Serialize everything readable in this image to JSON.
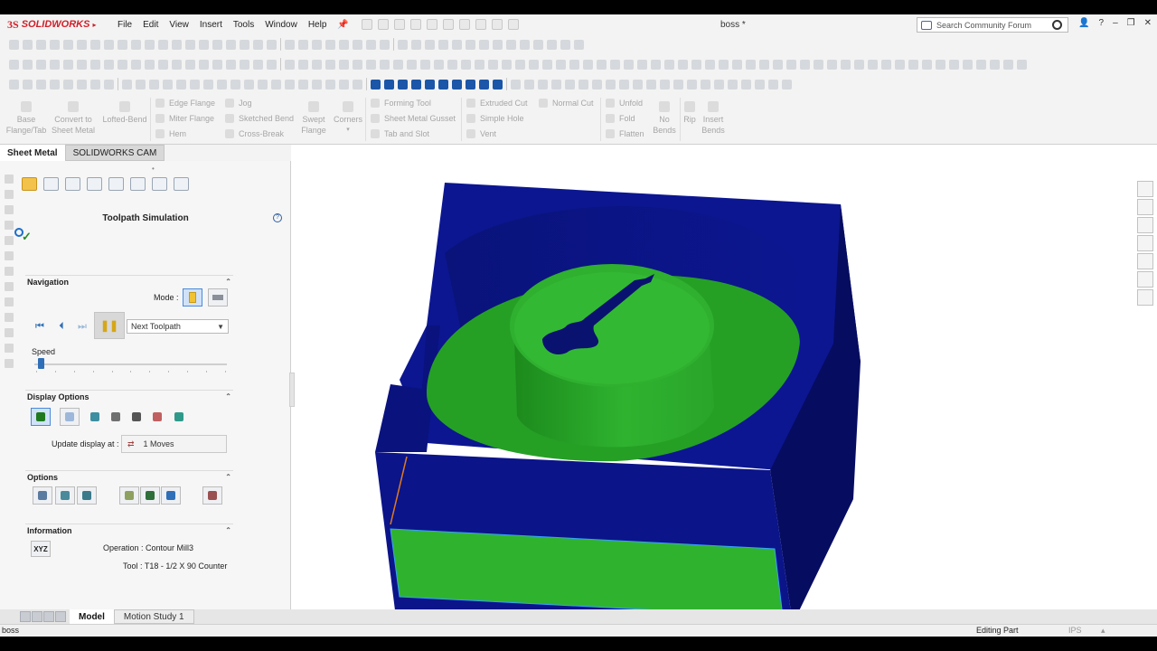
{
  "app": {
    "logo_mark": "3S",
    "logo_text": "SOLIDWORKS",
    "document_title": "boss *",
    "menu": [
      "File",
      "Edit",
      "View",
      "Insert",
      "Tools",
      "Window",
      "Help"
    ],
    "search_placeholder": "Search Community Forum",
    "window_controls": [
      "?",
      "–",
      "❐",
      "✕"
    ]
  },
  "command_manager": {
    "large": [
      {
        "label": "Base\nFlange/Tab"
      },
      {
        "label": "Convert to\nSheet Metal"
      },
      {
        "label": "Lofted-Bend"
      }
    ],
    "column1": [
      "Edge Flange",
      "Miter Flange",
      "Hem"
    ],
    "column2": [
      "Jog",
      "Sketched Bend",
      "Cross-Break"
    ],
    "swept": "Swept\nFlange",
    "corners": "Corners",
    "column3": [
      "Forming Tool",
      "Sheet Metal Gusset",
      "Tab and Slot"
    ],
    "column4": [
      "Extruded Cut",
      "Simple Hole",
      "Vent"
    ],
    "normal_cut": "Normal Cut",
    "column5": [
      "Unfold",
      "Fold",
      "Flatten"
    ],
    "no_bends": "No\nBends",
    "rip": "Rip",
    "insert_bends": "Insert\nBends"
  },
  "tabs": [
    "Sheet Metal",
    "SOLIDWORKS CAM"
  ],
  "property_manager": {
    "title": "Toolpath Simulation",
    "navigation": {
      "heading": "Navigation",
      "mode_label": "Mode :",
      "step_selected": "Next Toolpath",
      "speed_label": "Speed",
      "speed_level_percent": 2
    },
    "display_options": {
      "heading": "Display Options",
      "update_label": "Update display at :",
      "update_value": "1 Moves"
    },
    "options": {
      "heading": "Options"
    },
    "information": {
      "heading": "Information",
      "xyz_label": "XYZ",
      "operation": "Operation :  Contour Mill3",
      "tool": "Tool :  T18 - 1/2 X 90 Counter"
    }
  },
  "bottom_tabs": [
    "Model",
    "Motion Study 1"
  ],
  "status": {
    "left": "boss",
    "mode": "Editing Part",
    "units": "IPS"
  },
  "colors": {
    "stock_blue": "#0c1690",
    "stock_blue_dark": "#060c60",
    "machined_green": "#2fb32f",
    "accent_blue": "#2f6fb8",
    "tool_orange": "#e07b20"
  }
}
